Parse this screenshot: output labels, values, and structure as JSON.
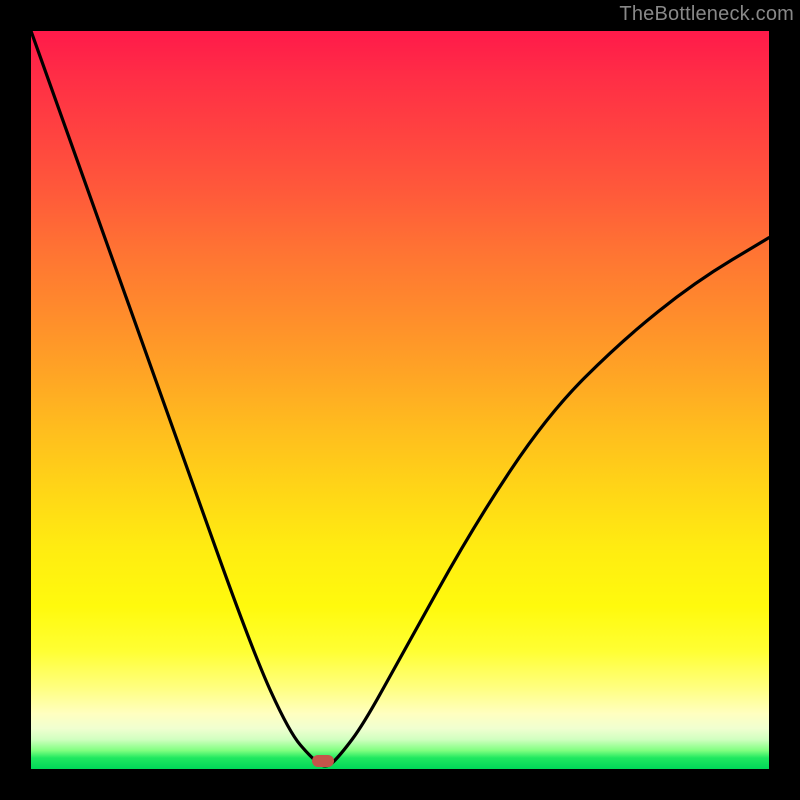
{
  "watermark": "TheBottleneck.com",
  "chart_data": {
    "type": "line",
    "title": "",
    "xlabel": "",
    "ylabel": "",
    "x": [
      0,
      10,
      20,
      30,
      35,
      38,
      40,
      42,
      45,
      50,
      60,
      70,
      80,
      90,
      100
    ],
    "values": [
      100,
      72,
      44,
      16,
      5,
      1.5,
      0,
      2,
      6,
      15,
      33,
      48,
      58,
      66,
      72
    ],
    "xlim": [
      0,
      100
    ],
    "ylim": [
      0,
      100
    ],
    "marker_x": 40,
    "marker_y": 0,
    "gradient_note": "background is vertical gradient from red (high y) through orange/yellow to green (low y), representing bottleneck severity"
  },
  "marker": {
    "shape": "rounded-pill",
    "color": "#c4554a"
  }
}
